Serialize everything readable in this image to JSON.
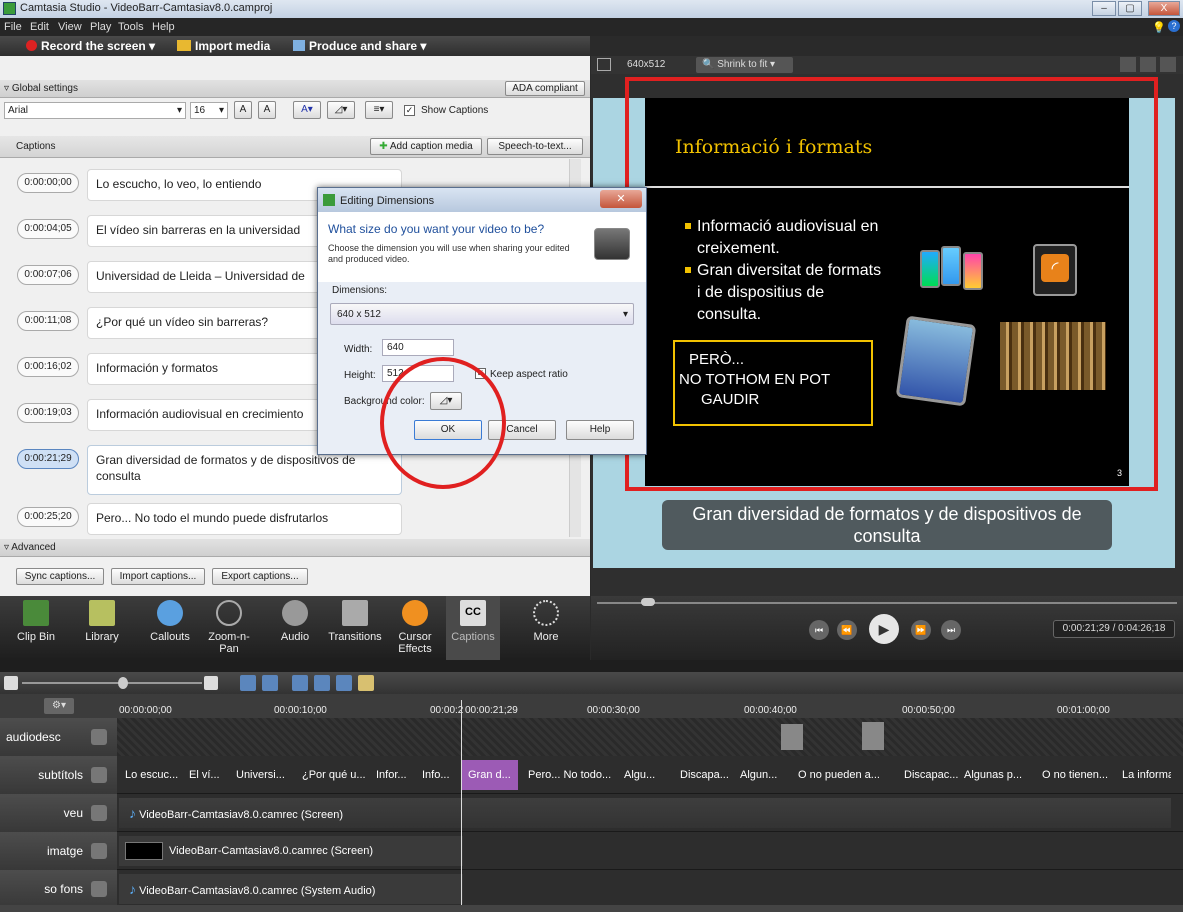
{
  "window": {
    "title": "Camtasia Studio - VideoBarr-Camtasiav8.0.camproj",
    "minimize": "–",
    "maximize": "▢",
    "close": "X"
  },
  "menu": [
    "File",
    "Edit",
    "View",
    "Play",
    "Tools",
    "Help"
  ],
  "toolbar": {
    "record": "Record the screen ▾",
    "import": "Import media",
    "produce": "Produce and share ▾"
  },
  "global": {
    "header": "Global settings",
    "ada": "ADA compliant",
    "font": "Arial",
    "size": "16",
    "show_captions": "Show Captions"
  },
  "captions_section": {
    "label": "Captions",
    "add_media": "Add caption media",
    "speech": "Speech-to-text..."
  },
  "captions": [
    {
      "time": "0:00:00;00",
      "text": "Lo escucho, lo veo, lo entiendo"
    },
    {
      "time": "0:00:04;05",
      "text": "El vídeo sin barreras en la universidad"
    },
    {
      "time": "0:00:07;06",
      "text": "Universidad de Lleida – Universidad de"
    },
    {
      "time": "0:00:11;08",
      "text": "¿Por qué un vídeo sin barreras?"
    },
    {
      "time": "0:00:16;02",
      "text": "Información y formatos"
    },
    {
      "time": "0:00:19;03",
      "text": "Información audiovisual en crecimiento"
    },
    {
      "time": "0:00:21;29",
      "text": "Gran diversidad de formatos y de dispositivos de consulta"
    },
    {
      "time": "0:00:25;20",
      "text": "Pero... No todo el mundo puede disfrutarlos"
    }
  ],
  "advanced": {
    "header": "Advanced",
    "sync": "Sync captions...",
    "import": "Import captions...",
    "export": "Export captions..."
  },
  "tabs": [
    "Clip Bin",
    "Library",
    "Callouts",
    "Zoom-n-Pan",
    "Audio",
    "Transitions",
    "Cursor Effects",
    "Captions",
    "More"
  ],
  "preview": {
    "dimension": "640x512",
    "zoom": "Shrink to fit",
    "slide_title": "Informació i formats",
    "bullets": [
      "Informació audiovisual en creixement.",
      "Gran diversitat de formats i de dispositius de consulta."
    ],
    "box_lines": [
      "PERÒ...",
      "NO TOTHOM EN POT",
      "GAUDIR"
    ],
    "page_num": "3",
    "caption": "Gran diversidad de formatos y de dispositivos de consulta",
    "time": "0:00:21;29 / 0:04:26;18",
    "cc_label": "CC"
  },
  "dialog": {
    "title": "Editing Dimensions",
    "heading": "What size do you want your video to be?",
    "desc": "Choose the dimension you will use when sharing your edited and produced video.",
    "dimensions_label": "Dimensions:",
    "dimensions_value": "640 x 512",
    "width_label": "Width:",
    "width_value": "640",
    "height_label": "Height:",
    "height_value": "512",
    "keep_aspect": "Keep aspect ratio",
    "bg_label": "Background color:",
    "ok": "OK",
    "cancel": "Cancel",
    "help": "Help"
  },
  "timeline": {
    "ruler": [
      "00:00:00;00",
      "00:00:10;00",
      "00:00:2",
      "00:00:21;29",
      "00:00:30;00",
      "00:00:40;00",
      "00:00:50;00",
      "00:01:00;00"
    ],
    "tracks": [
      {
        "name": "audiodesc",
        "clips": []
      },
      {
        "name": "subtítols",
        "clips": [
          "Lo escuc...",
          "El ví...",
          "Universi...",
          "¿Por qué u...",
          "Infor...",
          "Info...",
          "Gran d...",
          "Pero... No todo...",
          "Algu...",
          "Discapa...",
          "Algun...",
          "O no pueden a...",
          "Discapac...",
          "Algunas p...",
          "O no tienen...",
          "La informa"
        ]
      },
      {
        "name": "veu",
        "clips": [
          "VideoBarr-Camtasiav8.0.camrec (Screen)"
        ]
      },
      {
        "name": "imatge",
        "clips": [
          "VideoBarr-Camtasiav8.0.camrec (Screen)"
        ]
      },
      {
        "name": "so fons",
        "clips": [
          "VideoBarr-Camtasiav8.0.camrec (System Audio)"
        ]
      }
    ]
  },
  "colors": {
    "accent": "#e02020",
    "selected_clip": "#9c5bb5",
    "slide_title": "#f2c200"
  }
}
